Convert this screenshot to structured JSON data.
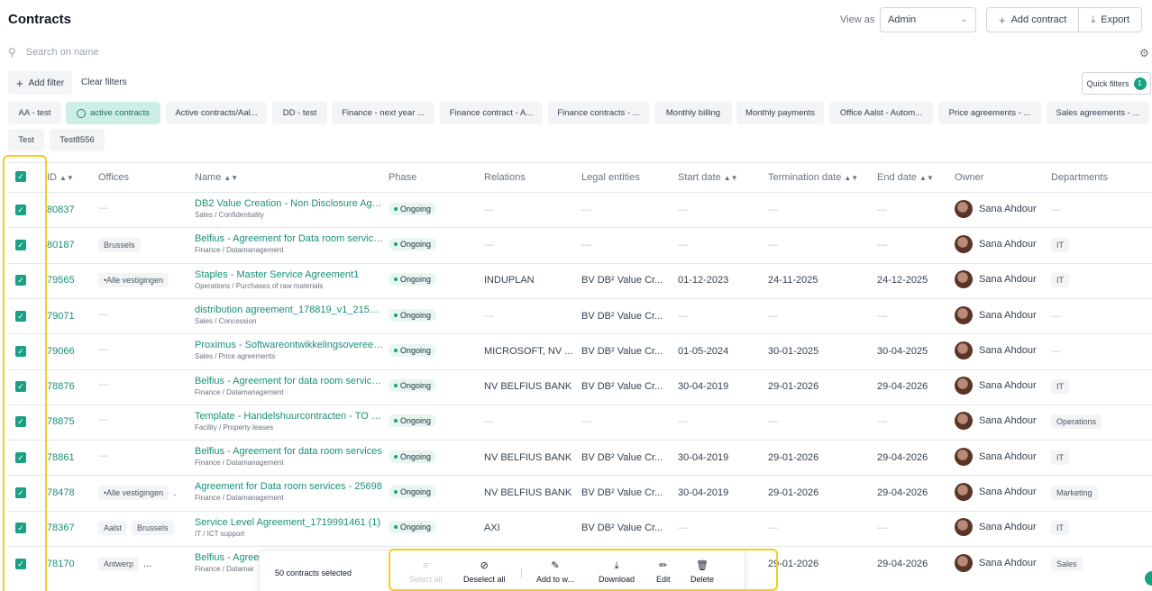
{
  "header": {
    "title": "Contracts",
    "view_as_label": "View as",
    "view_as_value": "Admin",
    "add_contract": "Add contract",
    "export": "Export"
  },
  "search": {
    "placeholder": "Search on name"
  },
  "filters": {
    "add_filter": "Add filter",
    "clear_filters": "Clear filters",
    "quick_filters": "Quick filters",
    "quick_filters_count": "1",
    "chips": [
      "AA - test",
      "active contracts",
      "Active contracts/Aal...",
      "DD - test",
      "Finance - next year ...",
      "Finance contract - A...",
      "Finance contracts - ...",
      "Monthly billing",
      "Monthly payments",
      "Office Aalst - Autom...",
      "Price agreements - ...",
      "Sales agreements - ...",
      "Test",
      "Test8556"
    ]
  },
  "table": {
    "columns": [
      "ID",
      "Offices",
      "Name",
      "Phase",
      "Relations",
      "Legal entities",
      "Start date",
      "Termination date",
      "End date",
      "Owner",
      "Departments"
    ],
    "dash": "—",
    "rows": [
      {
        "id": "80837",
        "offices": [
          "—"
        ],
        "name": "DB2 Value Creation - Non Disclosure Agre...",
        "category": "Sales / Confidentiality",
        "phase": "Ongoing",
        "relations": "—",
        "legal": "—",
        "start": "—",
        "termination": "—",
        "end": "—",
        "owner": "Sana Ahdour",
        "department": "—"
      },
      {
        "id": "80187",
        "offices": [
          "Brussels"
        ],
        "name": "Belfius - Agreement for Data room service...",
        "category": "Finance / Datamanagement",
        "phase": "Ongoing",
        "relations": "—",
        "legal": "—",
        "start": "—",
        "termination": "—",
        "end": "—",
        "owner": "Sana Ahdour",
        "department": "IT"
      },
      {
        "id": "79565",
        "offices": [
          "•Alle vestigingen"
        ],
        "name": "Staples - Master Service Agreement1",
        "category": "Operations / Purchases of raw materials",
        "phase": "Ongoing",
        "relations": "INDUPLAN",
        "legal": "BV DB² Value Cr...",
        "start": "01-12-2023",
        "termination": "24-11-2025",
        "end": "24-12-2025",
        "owner": "Sana Ahdour",
        "department": "IT"
      },
      {
        "id": "79071",
        "offices": [
          "—"
        ],
        "name": "distribution agreement_178819_v1_215565_...",
        "category": "Sales / Concession",
        "phase": "Ongoing",
        "relations": "—",
        "legal": "BV DB² Value Cr...",
        "start": "—",
        "termination": "—",
        "end": "—",
        "owner": "Sana Ahdour",
        "department": "—"
      },
      {
        "id": "79066",
        "offices": [
          "—"
        ],
        "name": "Proximus - Softwareontwikkelingsovereen...",
        "category": "Sales / Price agreements",
        "phase": "Ongoing",
        "relations": "MICROSOFT, NV ...",
        "legal": "BV DB² Value Cr...",
        "start": "01-05-2024",
        "termination": "30-01-2025",
        "end": "30-04-2025",
        "owner": "Sana Ahdour",
        "department": "—"
      },
      {
        "id": "78876",
        "offices": [
          "—"
        ],
        "name": "Belfius - Agreement for data room service...",
        "category": "Finance / Datamanagement",
        "phase": "Ongoing",
        "relations": "NV BELFIUS BANK",
        "legal": "BV DB² Value Cr...",
        "start": "30-04-2019",
        "termination": "29-01-2026",
        "end": "29-04-2026",
        "owner": "Sana Ahdour",
        "department": "IT"
      },
      {
        "id": "78875",
        "offices": [
          "—"
        ],
        "name": "Template - Handelshuurcontracten - TO C...",
        "category": "Facility / Property leases",
        "phase": "Ongoing",
        "relations": "—",
        "legal": "—",
        "start": "—",
        "termination": "—",
        "end": "—",
        "owner": "Sana Ahdour",
        "department": "Operations"
      },
      {
        "id": "78861",
        "offices": [
          "—"
        ],
        "name": "Belfius - Agreement for data room services",
        "category": "Finance / Datamanagement",
        "phase": "Ongoing",
        "relations": "NV BELFIUS BANK",
        "legal": "BV DB² Value Cr...",
        "start": "30-04-2019",
        "termination": "29-01-2026",
        "end": "29-04-2026",
        "owner": "Sana Ahdour",
        "department": "IT"
      },
      {
        "id": "78478",
        "offices": [
          "•Alle vestigingen",
          "."
        ],
        "name": "Agreement for Data room services - 25698",
        "category": "Finance / Datamanagement",
        "phase": "Ongoing",
        "relations": "NV BELFIUS BANK",
        "legal": "BV DB² Value Cr...",
        "start": "30-04-2019",
        "termination": "29-01-2026",
        "end": "29-04-2026",
        "owner": "Sana Ahdour",
        "department": "Marketing"
      },
      {
        "id": "78367",
        "offices": [
          "Aalst",
          "Brussels"
        ],
        "name": "Service Level Agreement_1719991461 (1)",
        "category": "IT / ICT support",
        "phase": "Ongoing",
        "relations": "AXI",
        "legal": "BV DB² Value Cr...",
        "start": "—",
        "termination": "—",
        "end": "—",
        "owner": "Sana Ahdour",
        "department": "IT"
      },
      {
        "id": "78170",
        "offices": [
          "Antwerp",
          "..."
        ],
        "name": "Belfius - Agree",
        "category": "Finance / Datamar",
        "phase": "",
        "relations": "",
        "legal": "",
        "start": "",
        "termination": "29-01-2026",
        "end": "29-04-2026",
        "owner": "Sana Ahdour",
        "department": "Sales"
      }
    ]
  },
  "bulk": {
    "count_label": "50 contracts selected",
    "select_all": "Select all",
    "deselect_all": "Deselect all",
    "add_to": "Add to w...",
    "download": "Download",
    "edit": "Edit",
    "delete": "Delete"
  },
  "colors": {
    "accent": "#1aa184",
    "highlight": "#f5cd1f"
  }
}
